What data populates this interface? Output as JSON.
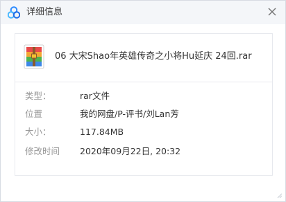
{
  "window": {
    "title": "详细信息",
    "close_icon": "close-icon",
    "app_icon": "cloud-icon"
  },
  "file": {
    "name": "06 大宋Shao年英雄传奇之小将Hu延庆 24回.rar",
    "icon": "rar-archive-icon"
  },
  "details": [
    {
      "label": "类型：",
      "value": "rar文件"
    },
    {
      "label": "位置",
      "value": "我的网盘/P-评书/刘Lan芳"
    },
    {
      "label": "大小：",
      "value": "117.84MB"
    },
    {
      "label": "修改时间",
      "value": "2020年09月22日, 20:32"
    }
  ]
}
